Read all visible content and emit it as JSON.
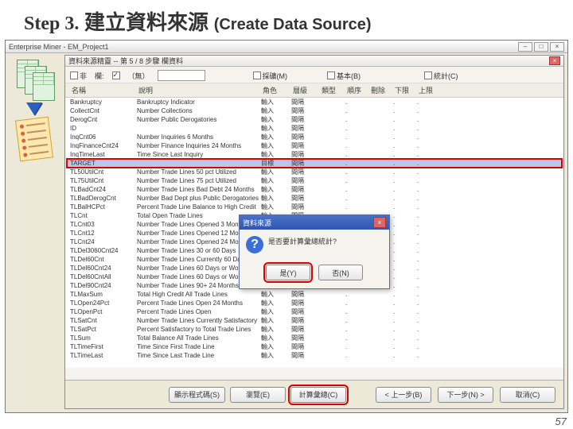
{
  "slide": {
    "step": "Step 3.",
    "title_zh": "建立資料來源",
    "title_en": "(Create Data Source)",
    "page": "57"
  },
  "app": {
    "title": "Enterprise Miner - EM_Project1",
    "minimize": "–",
    "maximize": "□",
    "close": "×"
  },
  "inner": {
    "title": "資料來源精靈 -- 第 5 / 8 步驟 欄資料"
  },
  "filter": {
    "col_label": "欄:",
    "col_value": "",
    "show_label": "（無）",
    "show_checked": true,
    "not_label": "非",
    "mining_label": "採礦(M)",
    "basic_label": "基本(B)",
    "stat_label": "統計(C)"
  },
  "headers": {
    "name": "名稱",
    "desc": "說明",
    "role": "角色",
    "level": "層級",
    "type": "類型",
    "order": "順序",
    "drop": "刪除",
    "lower": "下限",
    "upper": "上限"
  },
  "defaults": {
    "role_input": "輸入",
    "role_target": "目標",
    "level_interval": "間隔",
    "dot": "."
  },
  "rows": [
    {
      "n": "Bankruptcy",
      "d": "Bankruptcy Indicator"
    },
    {
      "n": "CollectCnt",
      "d": "Number Collections"
    },
    {
      "n": "DerogCnt",
      "d": "Number Public Derogatories"
    },
    {
      "n": "ID",
      "d": ""
    },
    {
      "n": "InqCnt06",
      "d": "Number Inquiries 6 Months"
    },
    {
      "n": "InqFinanceCnt24",
      "d": "Number Finance Inquiries 24 Months"
    },
    {
      "n": "InqTimeLast",
      "d": "Time Since Last Inquiry"
    },
    {
      "n": "TARGET",
      "d": "",
      "sel": true,
      "role": "目標"
    },
    {
      "n": "TL50UtilCnt",
      "d": "Number Trade Lines 50 pct Utilized"
    },
    {
      "n": "TL75UtilCnt",
      "d": "Number Trade Lines 75 pct Utilized"
    },
    {
      "n": "TLBadCnt24",
      "d": "Number Trade Lines Bad Debt 24 Months"
    },
    {
      "n": "TLBadDerogCnt",
      "d": "Number Bad Dept plus Public Derogatories"
    },
    {
      "n": "TLBalHCPct",
      "d": "Percent Trade Line Balance to High Credit"
    },
    {
      "n": "TLCnt",
      "d": "Total Open Trade Lines"
    },
    {
      "n": "TLCnt03",
      "d": "Number Trade Lines Opened 3 Months"
    },
    {
      "n": "TLCnt12",
      "d": "Number Trade Lines Opened 12 Months"
    },
    {
      "n": "TLCnt24",
      "d": "Number Trade Lines Opened 24 Months"
    },
    {
      "n": "TLDel3060Cnt24",
      "d": "Number Trade Lines 30 or 60 Days"
    },
    {
      "n": "TLDel60Cnt",
      "d": "Number Trade Lines Currently 60 Days"
    },
    {
      "n": "TLDel60Cnt24",
      "d": "Number Trade Lines 60 Days or Worse"
    },
    {
      "n": "TLDel60CntAll",
      "d": "Number Trade Lines 60 Days or Worse Ever"
    },
    {
      "n": "TLDel90Cnt24",
      "d": "Number Trade Lines 90+ 24 Months"
    },
    {
      "n": "TLMaxSum",
      "d": "Total High Credit All Trade Lines"
    },
    {
      "n": "TLOpen24Pct",
      "d": "Percent Trade Lines Open 24 Months"
    },
    {
      "n": "TLOpenPct",
      "d": "Percent Trade Lines Open"
    },
    {
      "n": "TLSatCnt",
      "d": "Number Trade Lines Currently Satisfactory"
    },
    {
      "n": "TLSatPct",
      "d": "Percent Satisfactory to Total Trade Lines"
    },
    {
      "n": "TLSum",
      "d": "Total Balance All Trade Lines"
    },
    {
      "n": "TLTimeFirst",
      "d": "Time Since First Trade Line"
    },
    {
      "n": "TLTimeLast",
      "d": "Time Since Last Trade Line"
    }
  ],
  "dialog": {
    "title": "資料來源",
    "message": "是否要計算彙總統計?",
    "yes": "是(Y)",
    "no": "否(N)"
  },
  "buttons": {
    "show_code": "顯示程式碼(S)",
    "explore": "瀏覽(E)",
    "compute": "計算彙總(C)",
    "back": "< 上一步(B)",
    "next": "下一步(N) >",
    "cancel": "取消(C)"
  }
}
